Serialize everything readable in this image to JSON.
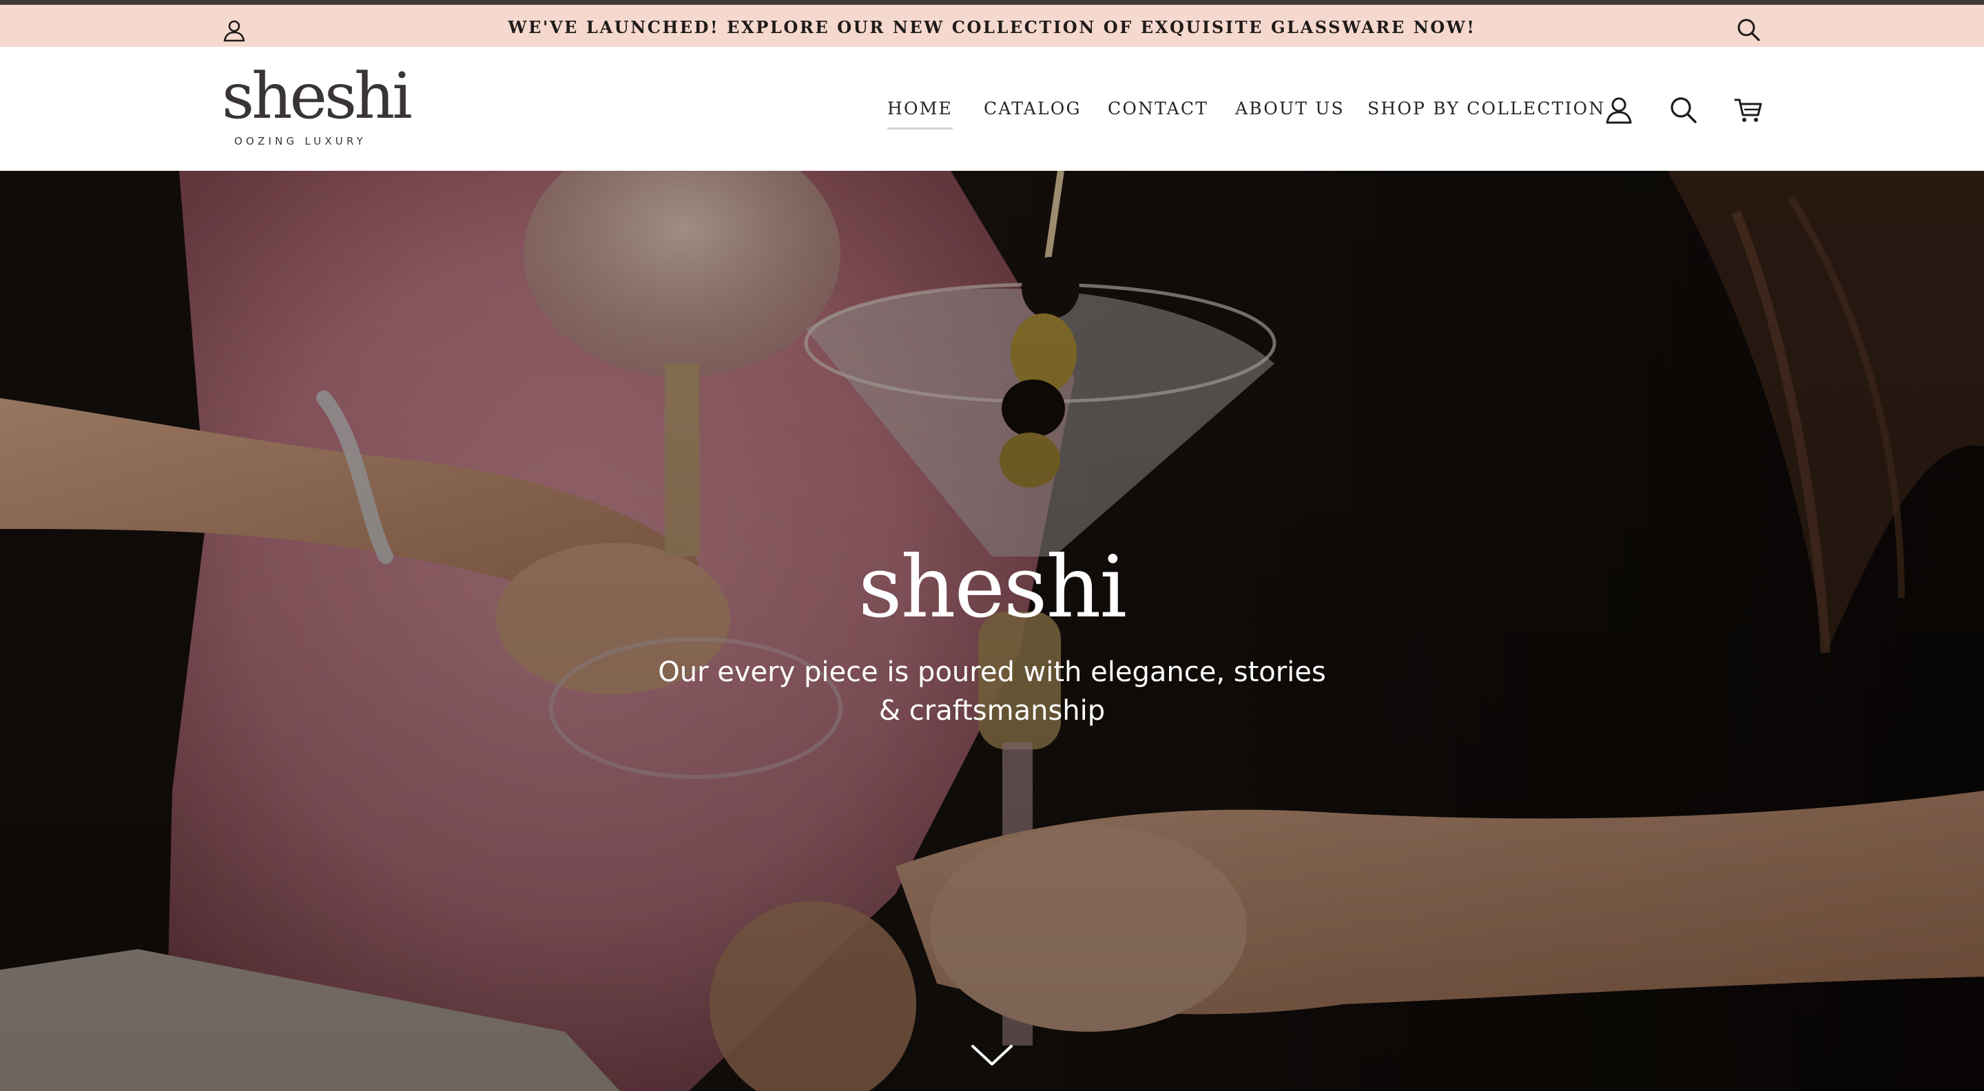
{
  "announcement": {
    "text": "WE'VE LAUNCHED! EXPLORE OUR NEW COLLECTION OF EXQUISITE GLASSWARE NOW!",
    "account_icon": "account-icon",
    "search_icon": "search-icon"
  },
  "header": {
    "logo_text": "sheshi",
    "logo_tagline": "OOZING LUXURY",
    "nav": [
      {
        "label": "HOME",
        "active": true
      },
      {
        "label": "CATALOG",
        "active": false
      },
      {
        "label": "CONTACT",
        "active": false
      },
      {
        "label": "ABOUT US",
        "active": false
      },
      {
        "label": "SHOP BY COLLECTION",
        "active": false
      }
    ],
    "icons": [
      "account-icon",
      "search-icon",
      "cart-icon"
    ]
  },
  "hero": {
    "title": "sheshi",
    "subtitle": "Our every piece is poured with elegance, stories & craftsmanship",
    "scroll_icon": "chevron-down-icon"
  },
  "colors": {
    "announcement_bg": "#f6d9ce",
    "text_dark": "#2a2626",
    "hero_text": "#ffffff"
  }
}
